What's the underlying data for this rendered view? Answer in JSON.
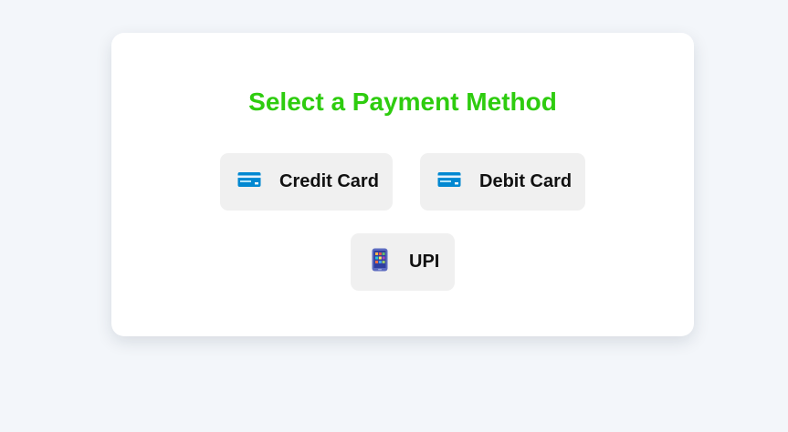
{
  "page": {
    "title": "Select a Payment Method",
    "title_color": "#2ecc0f",
    "background": "#f3f6fa"
  },
  "payment_methods": [
    {
      "label": "Credit Card",
      "icon": "credit-card-icon"
    },
    {
      "label": "Debit Card",
      "icon": "credit-card-icon"
    },
    {
      "label": "UPI",
      "icon": "mobile-phone-icon"
    }
  ]
}
